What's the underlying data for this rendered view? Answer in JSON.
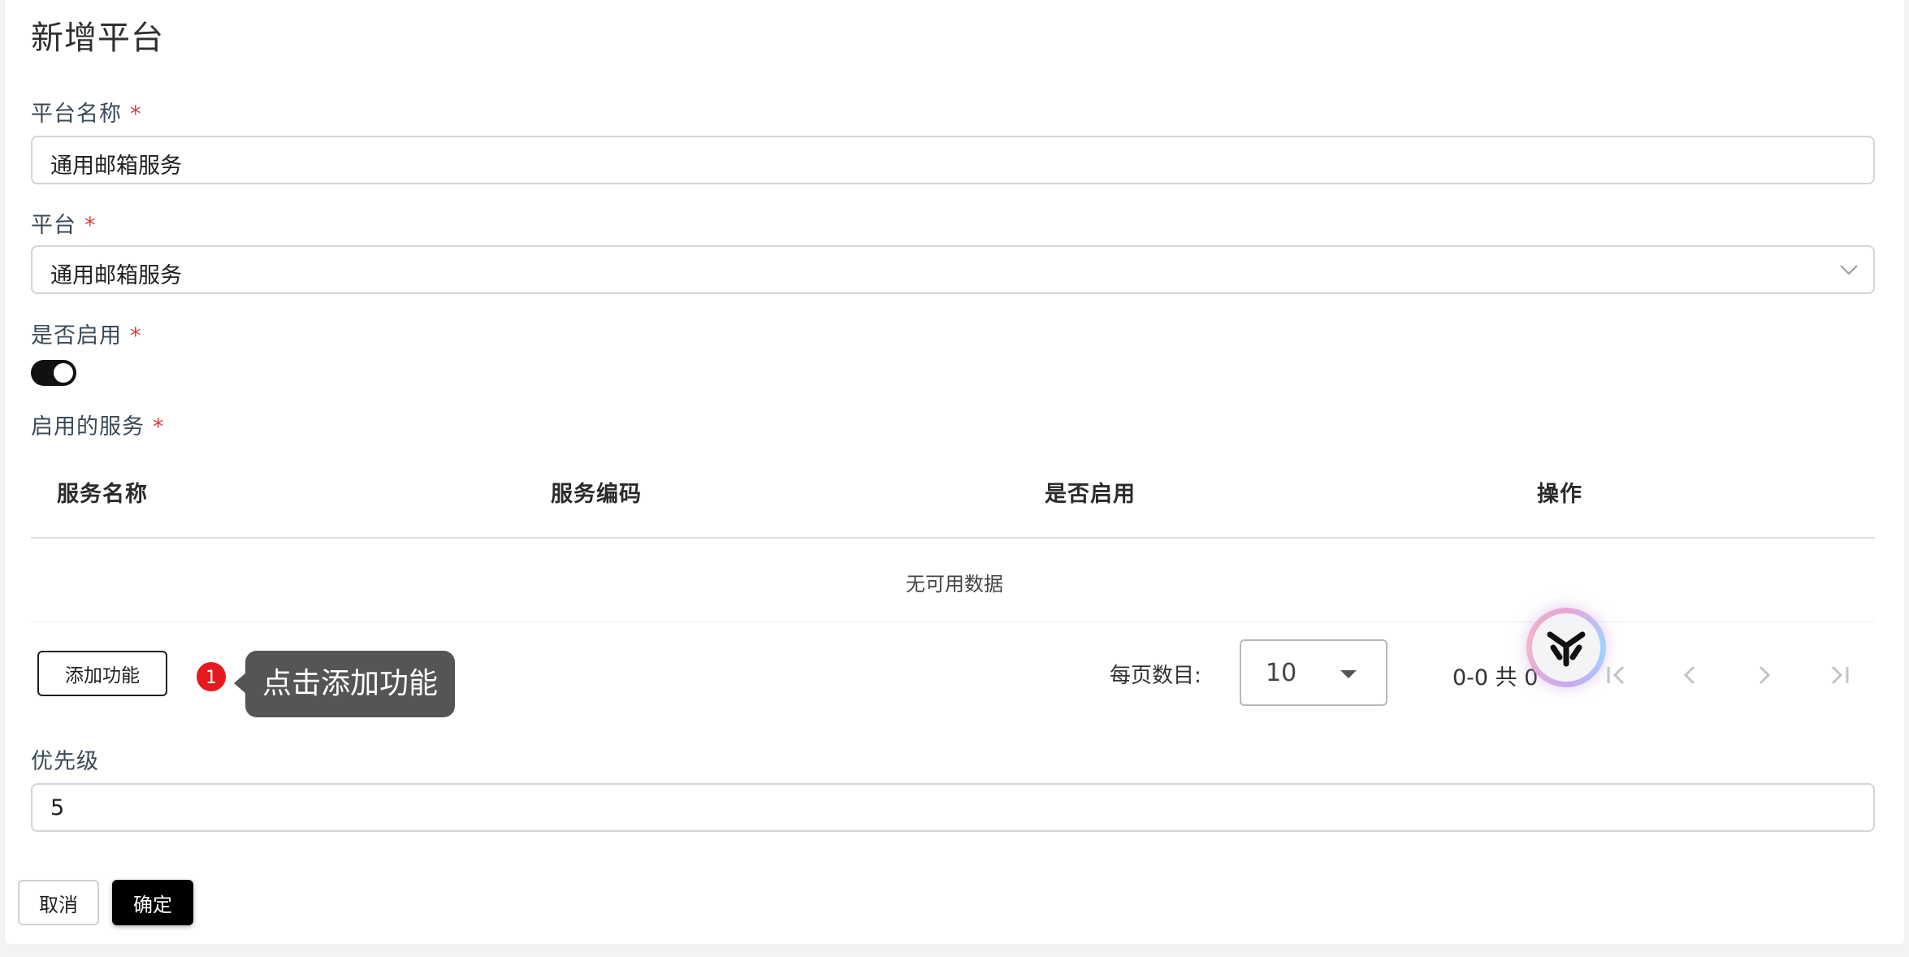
{
  "dialog": {
    "title": "新增平台"
  },
  "form": {
    "platform_name": {
      "label": "平台名称",
      "required_mark": "*",
      "value": "通用邮箱服务"
    },
    "platform": {
      "label": "平台",
      "required_mark": "*",
      "value": "通用邮箱服务"
    },
    "enabled": {
      "label": "是否启用",
      "required_mark": "*",
      "on": true
    },
    "services": {
      "label": "启用的服务",
      "required_mark": "*"
    },
    "priority": {
      "label": "优先级",
      "value": "5"
    }
  },
  "table": {
    "columns": [
      "服务名称",
      "服务编码",
      "是否启用",
      "操作"
    ],
    "empty_text": "无可用数据"
  },
  "add_function_button": "添加功能",
  "guide": {
    "step_number": "1",
    "tooltip": "点击添加功能"
  },
  "pagination": {
    "per_page_label": "每页数目:",
    "per_page_value": "10",
    "range_text": "0-0 共 0"
  },
  "footer": {
    "cancel_label": "取消",
    "confirm_label": "确定"
  },
  "colors": {
    "required": "#e03c3c",
    "badge": "#e8191e",
    "tooltip_bg": "#555558",
    "primary_button": "#000000"
  },
  "icons": {
    "select_arrow": "chevron-down-icon",
    "per_page_arrow": "caret-down-icon",
    "first_page": "first-page-icon",
    "prev_page": "chevron-left-icon",
    "next_page": "chevron-right-icon",
    "last_page": "last-page-icon",
    "assistant": "assistant-logo-icon"
  }
}
